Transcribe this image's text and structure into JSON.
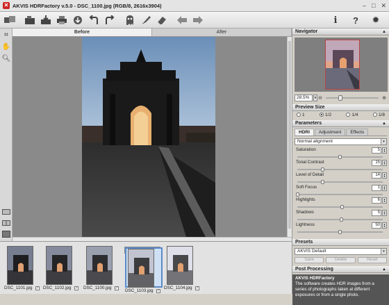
{
  "window": {
    "title": "AKVIS HDRFactory v.5.0 - DSC_1100.jpg (RGB/8, 2616x3904)",
    "app_icon": "akvis-icon"
  },
  "toolbar": {
    "icons": [
      "open-icon",
      "save-icon",
      "print-icon",
      "import-icon",
      "undo-icon",
      "redo-icon",
      "ghost-icon",
      "brush-icon",
      "eraser-icon",
      "back-arrow-icon",
      "forward-arrow-icon",
      "info-icon",
      "help-icon",
      "settings-icon"
    ]
  },
  "tabs": {
    "before": "Before",
    "after": "After"
  },
  "filmstrip": [
    {
      "name": "DSC_1101.jpg",
      "checked": true,
      "selected": false
    },
    {
      "name": "DSC_1102.jpg",
      "checked": true,
      "selected": false
    },
    {
      "name": "DSC_1100.jpg",
      "checked": true,
      "selected": false
    },
    {
      "name": "DSC_1103.jpg",
      "checked": true,
      "selected": true
    },
    {
      "name": "DSC_1104.jpg",
      "checked": true,
      "selected": false
    }
  ],
  "navigator": {
    "title": "Navigator",
    "zoom": "28.5%",
    "zoom_level": 0.28
  },
  "preview_size": {
    "title": "Preview Size",
    "options": [
      "1",
      "1/2",
      "1/4",
      "1/8"
    ],
    "selected": "1/2"
  },
  "parameters": {
    "title": "Parameters",
    "tabs": [
      "HDRI",
      "Adjustment",
      "Effects"
    ],
    "active_tab": "HDRI",
    "mode": "Normal alignment",
    "items": [
      {
        "label": "Saturation",
        "value": "5",
        "pos": 0.5
      },
      {
        "label": "Tonal Contrast",
        "value": "15",
        "pos": 0.3
      },
      {
        "label": "Level of Detail",
        "value": "14",
        "pos": 0.3
      },
      {
        "label": "Soft Focus",
        "value": "1",
        "pos": 0.01
      },
      {
        "label": "Highlights",
        "value": "6",
        "pos": 0.53
      },
      {
        "label": "Shadows",
        "value": "5",
        "pos": 0.52
      },
      {
        "label": "Lightness",
        "value": "50",
        "pos": 0.5
      }
    ]
  },
  "presets": {
    "title": "Presets",
    "current": "AKVIS Default",
    "save": "Save",
    "delete": "Delete",
    "reset": "Reset"
  },
  "post_processing": {
    "title": "Post Processing"
  },
  "info": {
    "heading": "AKVIS HDRFactory",
    "text": "The software creates HDR images from a series of photographs taken at different exposures or from a single photo."
  }
}
